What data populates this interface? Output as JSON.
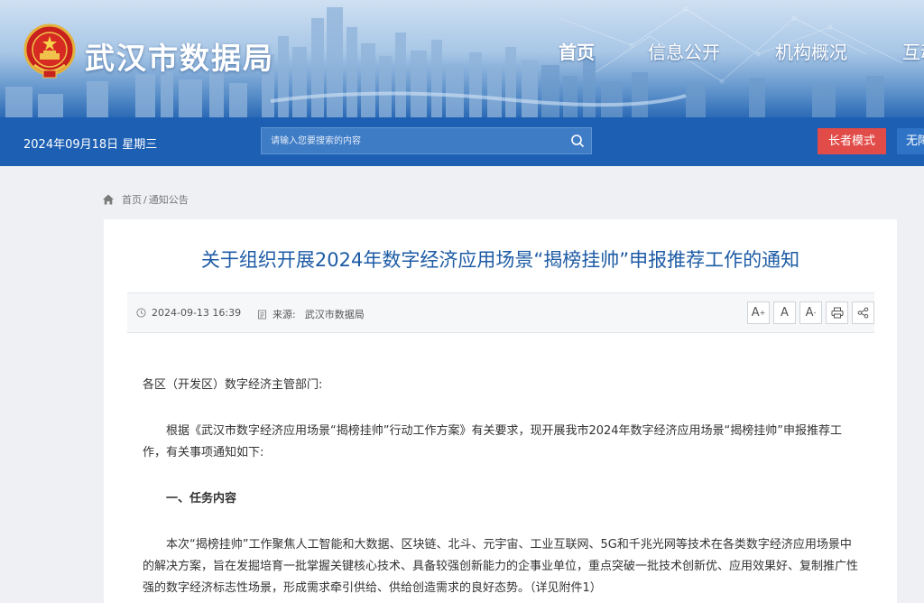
{
  "header": {
    "site_title": "武汉市数据局",
    "nav": [
      {
        "label": "首页",
        "active": true
      },
      {
        "label": "信息公开",
        "active": false
      },
      {
        "label": "机构概况",
        "active": false
      },
      {
        "label": "互动",
        "active": false
      }
    ]
  },
  "topbar": {
    "date": "2024年09月18日 星期三",
    "search_placeholder": "请输入您要搜索的内容",
    "elder_mode": "长者模式",
    "accessible": "无障"
  },
  "breadcrumb": {
    "items": [
      "首页",
      "通知公告"
    ],
    "separator": "/"
  },
  "article": {
    "title": "关于组织开展2024年数字经济应用场景“揭榜挂帅”申报推荐工作的通知",
    "datetime": "2024-09-13 16:39",
    "source_label": "来源:",
    "source": "武汉市数据局",
    "tools": {
      "font_larger": "A",
      "font_normal": "A",
      "font_smaller": "A"
    },
    "salutation": "各区（开发区）数字经济主管部门:",
    "para1": "根据《武汉市数字经济应用场景“揭榜挂帅”行动工作方案》有关要求，现开展我市2024年数字经济应用场景“揭榜挂帅”申报推荐工作，有关事项通知如下:",
    "section1_title": "一、任务内容",
    "para2": "本次“揭榜挂帅”工作聚焦人工智能和大数据、区块链、北斗、元宇宙、工业互联网、5G和千兆光网等技术在各类数字经济应用场景中的解决方案，旨在发掘培育一批掌握关键核心技术、具备较强创新能力的企事业单位，重点突破一批技术创新优、应用效果好、复制推广性强的数字经济标志性场景，形成需求牵引供给、供给创造需求的良好态势。（详见附件1）"
  },
  "colors": {
    "primary_blue": "#1c5fb3",
    "title_blue": "#1d5ba5",
    "elder_red": "#e14b48"
  }
}
